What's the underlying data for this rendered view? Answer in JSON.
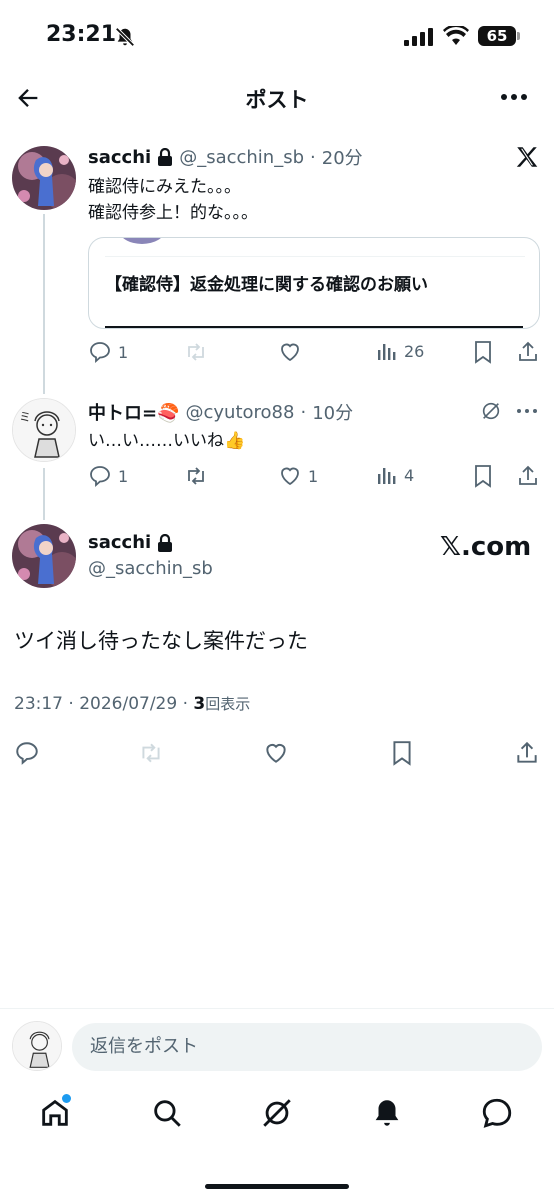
{
  "status_bar": {
    "time": "23:21",
    "battery": "65"
  },
  "header": {
    "title": "ポスト"
  },
  "quoted_post": {
    "name": "sacchi",
    "handle": "@_sacchin_sb",
    "time": "20分",
    "lines": [
      "確認侍にみえた。。。",
      "確認侍参上！的な。。。"
    ],
    "card_title": "【確認侍】返金処理に関する確認のお願い",
    "replies": "1",
    "views": "26"
  },
  "reply_post": {
    "name": "中トロ=🍣",
    "handle": "@cyutoro88",
    "time": "10分",
    "text": "い…い……いいね👍",
    "replies": "1",
    "likes": "1",
    "views": "4"
  },
  "main_post": {
    "name": "sacchi",
    "handle": "@_sacchin_sb",
    "watermark": "𝕏.com",
    "text": "ツイ消し待ったなし案件だった",
    "timestamp": "23:17 · 2026/07/29 · ",
    "view_count": "3",
    "view_label": "回表示"
  },
  "reply_bar": {
    "placeholder": "返信をポスト"
  },
  "colors": {
    "notification_dot": "#1d9bf0",
    "text": "#0f1419",
    "muted": "#536471"
  }
}
